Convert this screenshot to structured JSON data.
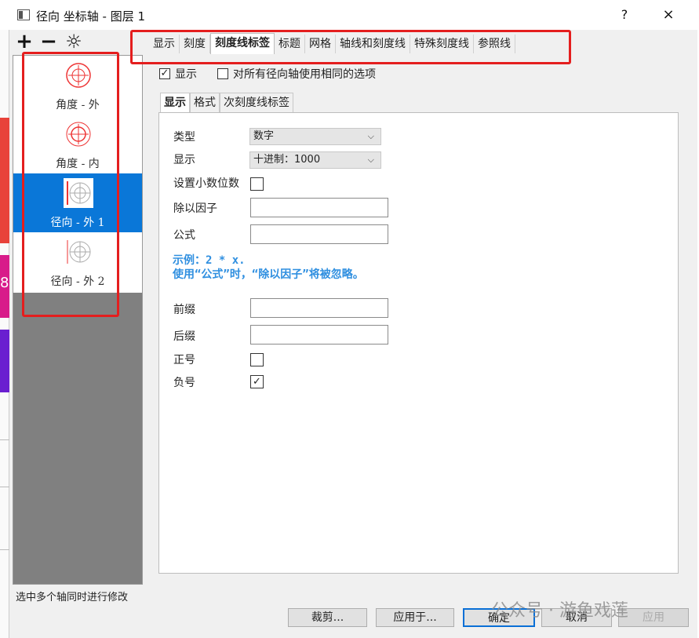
{
  "window": {
    "title": "径向 坐标轴 - 图层 1",
    "help": "?",
    "close": "×"
  },
  "toolbar": {
    "add": "+",
    "remove": "−",
    "settings": "☼"
  },
  "axes": [
    {
      "label": "角度 - 外",
      "selected": false
    },
    {
      "label": "角度 - 内",
      "selected": false
    },
    {
      "label": "径向 - 外 1",
      "selected": true
    },
    {
      "label": "径向 - 外 2",
      "selected": false
    }
  ],
  "hint": "选中多个轴同时进行修改",
  "top_tabs": [
    "显示",
    "刻度",
    "刻度线标签",
    "标题",
    "网格",
    "轴线和刻度线",
    "特殊刻度线",
    "参照线"
  ],
  "active_top_tab": "刻度线标签",
  "show_checkbox": {
    "label": "显示",
    "checked": true
  },
  "same_options_checkbox": {
    "label": "对所有径向轴使用相同的选项",
    "checked": false
  },
  "sub_tabs": [
    "显示",
    "格式",
    "次刻度线标签"
  ],
  "active_sub_tab": "显示",
  "form": {
    "type_label": "类型",
    "type_value": "数字",
    "display_label": "显示",
    "display_value": "十进制：1000",
    "decimal_label": "设置小数位数",
    "divide_label": "除以因子",
    "divide_value": "",
    "formula_label": "公式",
    "formula_value": "",
    "example_line1": "示例：2 * x.",
    "example_line2": "使用“公式”时，“除以因子”将被忽略。",
    "prefix_label": "前缀",
    "prefix_value": "",
    "suffix_label": "后缀",
    "suffix_value": "",
    "plus_label": "正号",
    "plus_checked": false,
    "minus_label": "负号",
    "minus_checked": true
  },
  "buttons": {
    "crop": "裁剪...",
    "apply_to": "应用于...",
    "ok": "确定",
    "cancel": "取消",
    "apply": "应用"
  },
  "left_pie_number": "8",
  "watermark": "公众号 · 游鱼戏莲",
  "colors": {
    "selection": "#0a77d8",
    "highlight_box": "#e41e1e",
    "example_text": "#2f8fe0"
  }
}
